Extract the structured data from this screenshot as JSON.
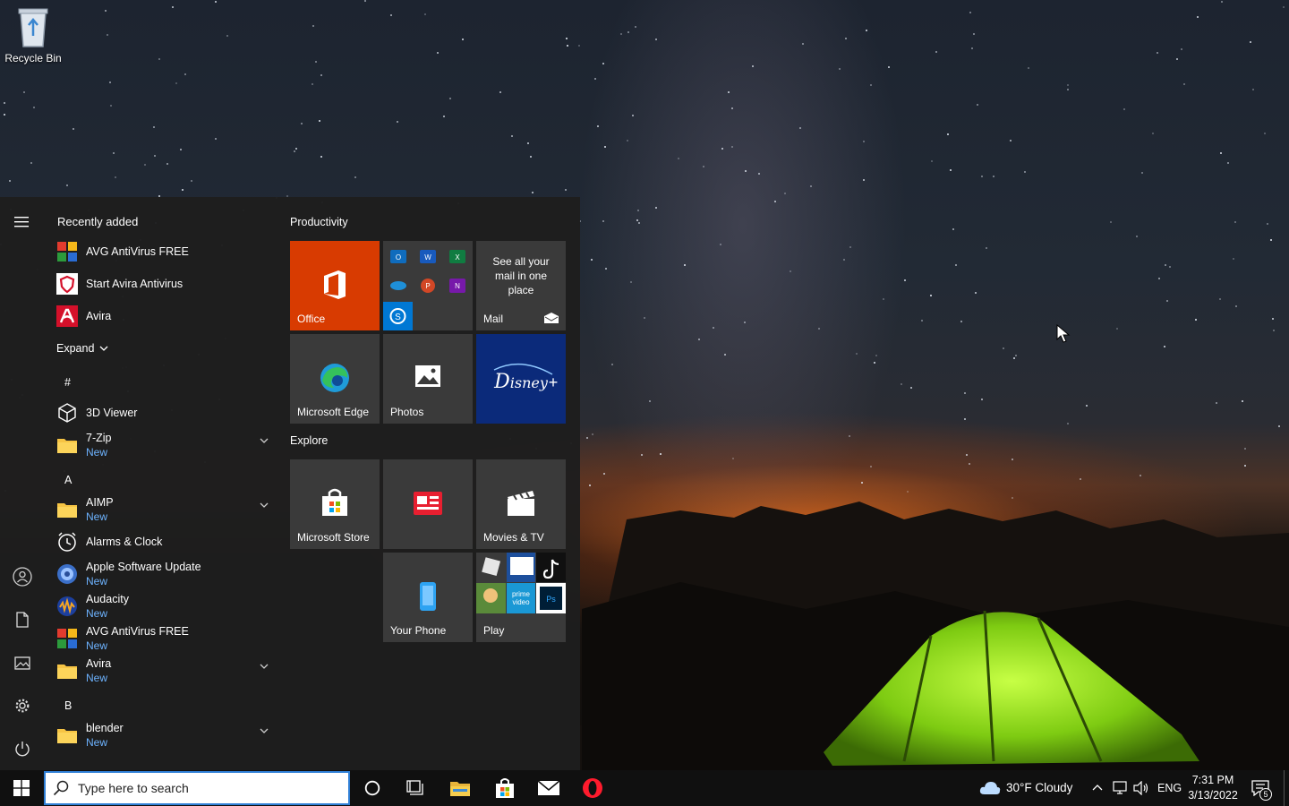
{
  "desktop": {
    "recycle_bin_label": "Recycle Bin"
  },
  "start_menu": {
    "recently_added_title": "Recently added",
    "recent_items": [
      {
        "label": "AVG AntiVirus FREE",
        "icon": "avg-icon"
      },
      {
        "label": "Start Avira Antivirus",
        "icon": "avira-shield-icon"
      },
      {
        "label": "Avira",
        "icon": "avira-icon"
      }
    ],
    "expand_label": "Expand",
    "sections": {
      "hash": "#",
      "a": "A",
      "b": "B"
    },
    "apps": [
      {
        "label": "3D Viewer",
        "sub": ""
      },
      {
        "label": "7-Zip",
        "sub": "New"
      },
      {
        "label": "AIMP",
        "sub": "New"
      },
      {
        "label": "Alarms & Clock",
        "sub": ""
      },
      {
        "label": "Apple Software Update",
        "sub": "New"
      },
      {
        "label": "Audacity",
        "sub": "New"
      },
      {
        "label": "AVG AntiVirus FREE",
        "sub": "New"
      },
      {
        "label": "Avira",
        "sub": "New"
      },
      {
        "label": "blender",
        "sub": "New"
      }
    ],
    "groups": {
      "productivity": "Productivity",
      "explore": "Explore"
    },
    "tiles": {
      "office": "Office",
      "mail_blurb": "See all your mail in one place",
      "mail": "Mail",
      "edge": "Microsoft Edge",
      "photos": "Photos",
      "store": "Microsoft Store",
      "movies": "Movies & TV",
      "phone": "Your Phone",
      "play": "Play"
    },
    "colors": {
      "office_tile": "#d83b01",
      "disney_tile": "#0b2a7a",
      "new_badge": "#6db3ff"
    }
  },
  "taskbar": {
    "search_placeholder": "Type here to search",
    "weather": "30°F  Cloudy",
    "language": "ENG",
    "time": "7:31 PM",
    "date": "3/13/2022",
    "notification_count": "5"
  }
}
